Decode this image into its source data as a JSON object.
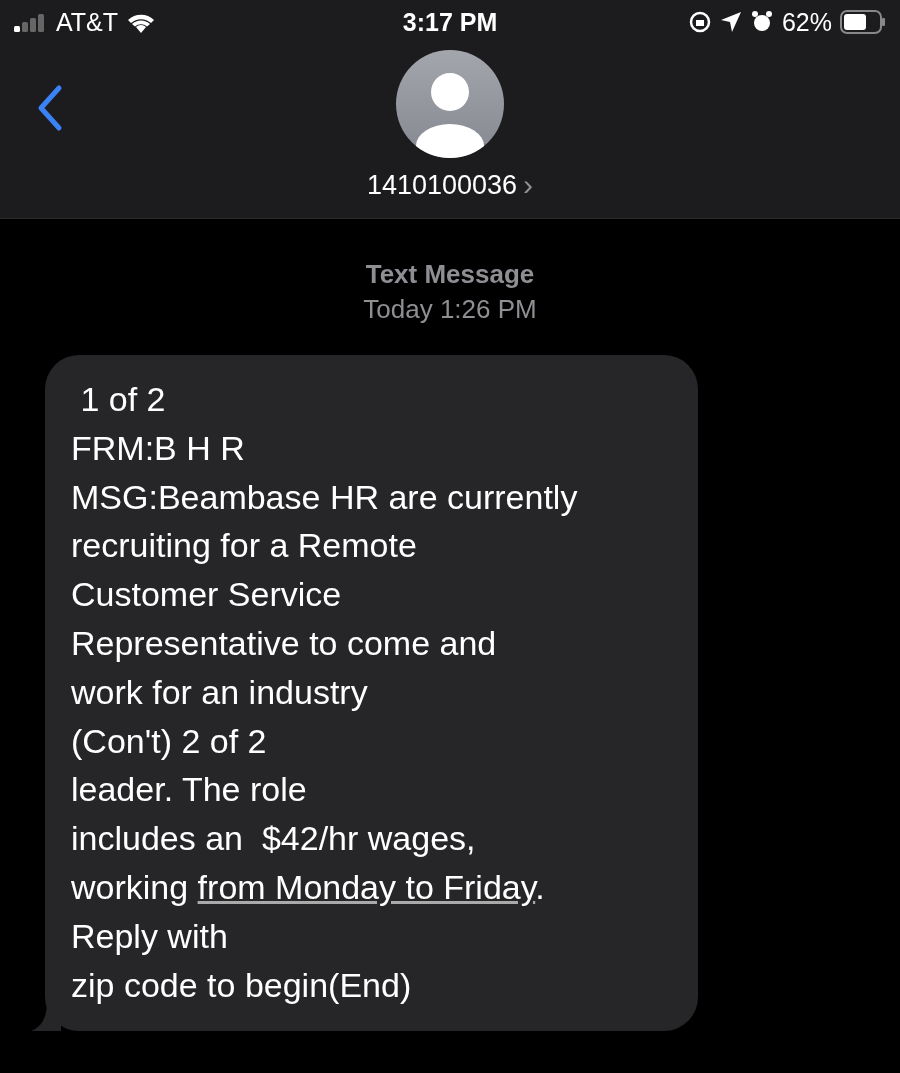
{
  "status_bar": {
    "carrier": "AT&T",
    "time": "3:17 PM",
    "battery": "62%"
  },
  "header": {
    "contact": "1410100036",
    "chevron": "›"
  },
  "thread": {
    "service": "Text Message",
    "timestamp": "Today 1:26 PM"
  },
  "message": {
    "lines": [
      [
        {
          "kind": "text",
          "text": " 1 of 2"
        }
      ],
      [
        {
          "kind": "text",
          "text": "FRM:B H R"
        }
      ],
      [
        {
          "kind": "text",
          "text": "MSG:Beambase HR are currently"
        }
      ],
      [
        {
          "kind": "text",
          "text": "recruiting for a Remote"
        }
      ],
      [
        {
          "kind": "text",
          "text": "Customer Service"
        }
      ],
      [
        {
          "kind": "text",
          "text": "Representative to come and"
        }
      ],
      [
        {
          "kind": "text",
          "text": "work for an industry"
        }
      ],
      [
        {
          "kind": "text",
          "text": "(Con't) 2 of 2"
        }
      ],
      [
        {
          "kind": "text",
          "text": "leader. The role"
        }
      ],
      [
        {
          "kind": "text",
          "text": "includes an  $42/hr wages,"
        }
      ],
      [
        {
          "kind": "text",
          "text": "working "
        },
        {
          "kind": "link",
          "text": "from Monday to Friday"
        },
        {
          "kind": "text",
          "text": "."
        }
      ],
      [
        {
          "kind": "text",
          "text": "Reply with"
        }
      ],
      [
        {
          "kind": "text",
          "text": "zip code to begin(End)"
        }
      ]
    ]
  }
}
